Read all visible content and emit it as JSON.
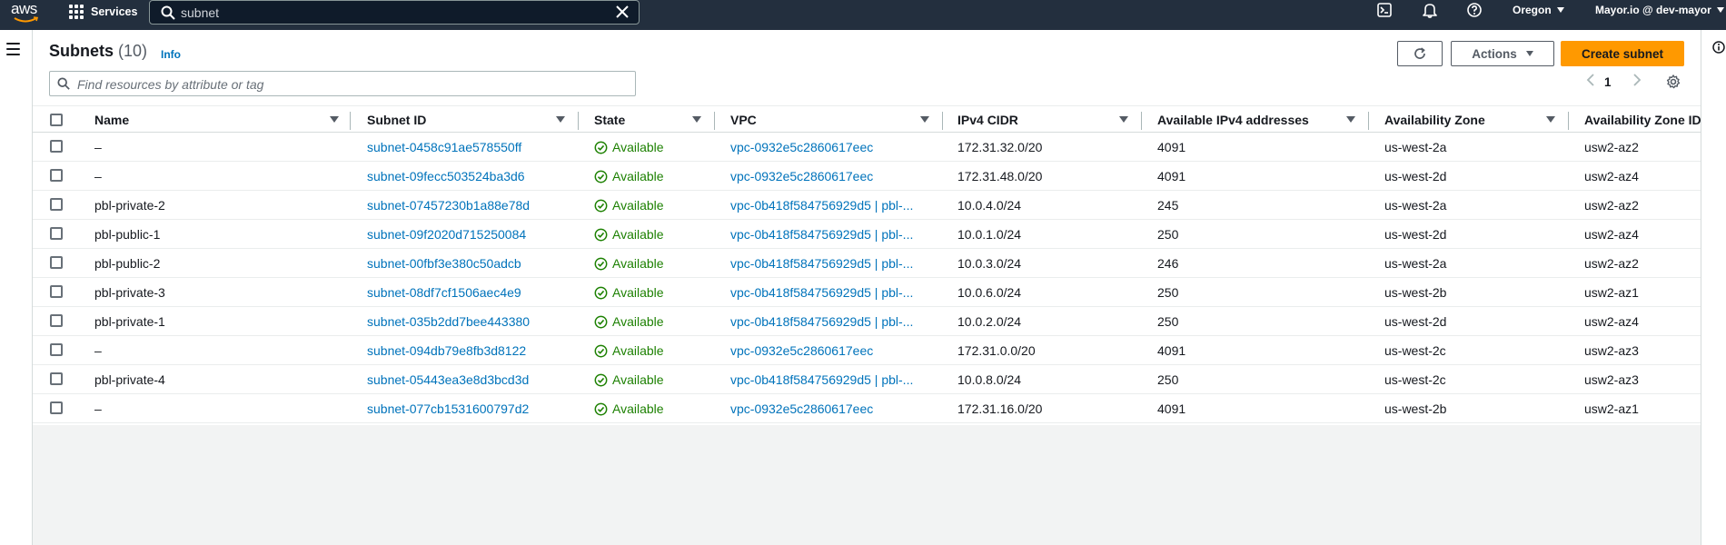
{
  "topnav": {
    "logo_text": "aws",
    "services_label": "Services",
    "search_value": "subnet",
    "region_label": "Oregon",
    "account_label": "Mayor.io @ dev-mayor"
  },
  "header": {
    "title": "Subnets",
    "count": "(10)",
    "info_label": "Info",
    "actions_label": "Actions",
    "create_label": "Create subnet"
  },
  "filter": {
    "placeholder": "Find resources by attribute or tag"
  },
  "pagination": {
    "current_page": "1"
  },
  "table": {
    "columns": [
      "Name",
      "Subnet ID",
      "State",
      "VPC",
      "IPv4 CIDR",
      "Available IPv4 addresses",
      "Availability Zone",
      "Availability Zone ID"
    ],
    "rows": [
      {
        "name": "–",
        "subnet_id": "subnet-0458c91ae578550ff",
        "state": "Available",
        "vpc": "vpc-0932e5c2860617eec",
        "cidr": "172.31.32.0/20",
        "available_ips": "4091",
        "az": "us-west-2a",
        "az_id": "usw2-az2"
      },
      {
        "name": "–",
        "subnet_id": "subnet-09fecc503524ba3d6",
        "state": "Available",
        "vpc": "vpc-0932e5c2860617eec",
        "cidr": "172.31.48.0/20",
        "available_ips": "4091",
        "az": "us-west-2d",
        "az_id": "usw2-az4"
      },
      {
        "name": "pbl-private-2",
        "subnet_id": "subnet-07457230b1a88e78d",
        "state": "Available",
        "vpc": "vpc-0b418f584756929d5 | pbl-...",
        "cidr": "10.0.4.0/24",
        "available_ips": "245",
        "az": "us-west-2a",
        "az_id": "usw2-az2"
      },
      {
        "name": "pbl-public-1",
        "subnet_id": "subnet-09f2020d715250084",
        "state": "Available",
        "vpc": "vpc-0b418f584756929d5 | pbl-...",
        "cidr": "10.0.1.0/24",
        "available_ips": "250",
        "az": "us-west-2d",
        "az_id": "usw2-az4"
      },
      {
        "name": "pbl-public-2",
        "subnet_id": "subnet-00fbf3e380c50adcb",
        "state": "Available",
        "vpc": "vpc-0b418f584756929d5 | pbl-...",
        "cidr": "10.0.3.0/24",
        "available_ips": "246",
        "az": "us-west-2a",
        "az_id": "usw2-az2"
      },
      {
        "name": "pbl-private-3",
        "subnet_id": "subnet-08df7cf1506aec4e9",
        "state": "Available",
        "vpc": "vpc-0b418f584756929d5 | pbl-...",
        "cidr": "10.0.6.0/24",
        "available_ips": "250",
        "az": "us-west-2b",
        "az_id": "usw2-az1"
      },
      {
        "name": "pbl-private-1",
        "subnet_id": "subnet-035b2dd7bee443380",
        "state": "Available",
        "vpc": "vpc-0b418f584756929d5 | pbl-...",
        "cidr": "10.0.2.0/24",
        "available_ips": "250",
        "az": "us-west-2d",
        "az_id": "usw2-az4"
      },
      {
        "name": "–",
        "subnet_id": "subnet-094db79e8fb3d8122",
        "state": "Available",
        "vpc": "vpc-0932e5c2860617eec",
        "cidr": "172.31.0.0/20",
        "available_ips": "4091",
        "az": "us-west-2c",
        "az_id": "usw2-az3"
      },
      {
        "name": "pbl-private-4",
        "subnet_id": "subnet-05443ea3e8d3bcd3d",
        "state": "Available",
        "vpc": "vpc-0b418f584756929d5 | pbl-...",
        "cidr": "10.0.8.0/24",
        "available_ips": "250",
        "az": "us-west-2c",
        "az_id": "usw2-az3"
      },
      {
        "name": "–",
        "subnet_id": "subnet-077cb1531600797d2",
        "state": "Available",
        "vpc": "vpc-0932e5c2860617eec",
        "cidr": "172.31.16.0/20",
        "available_ips": "4091",
        "az": "us-west-2b",
        "az_id": "usw2-az1"
      }
    ]
  },
  "icons": {
    "services": "grid-icon",
    "search": "search-icon",
    "clear": "close-icon",
    "cloudshell": "terminal-icon",
    "notifications": "bell-icon",
    "help": "help-icon",
    "menu": "hamburger-menu-icon",
    "refresh": "refresh-icon",
    "settings": "gear-icon",
    "state": "check-circle-icon",
    "info_panel": "info-icon"
  },
  "colors": {
    "nav_bg": "#232f3e",
    "primary_button": "#ff9900",
    "link": "#0073bb",
    "status_success": "#1d8102"
  }
}
